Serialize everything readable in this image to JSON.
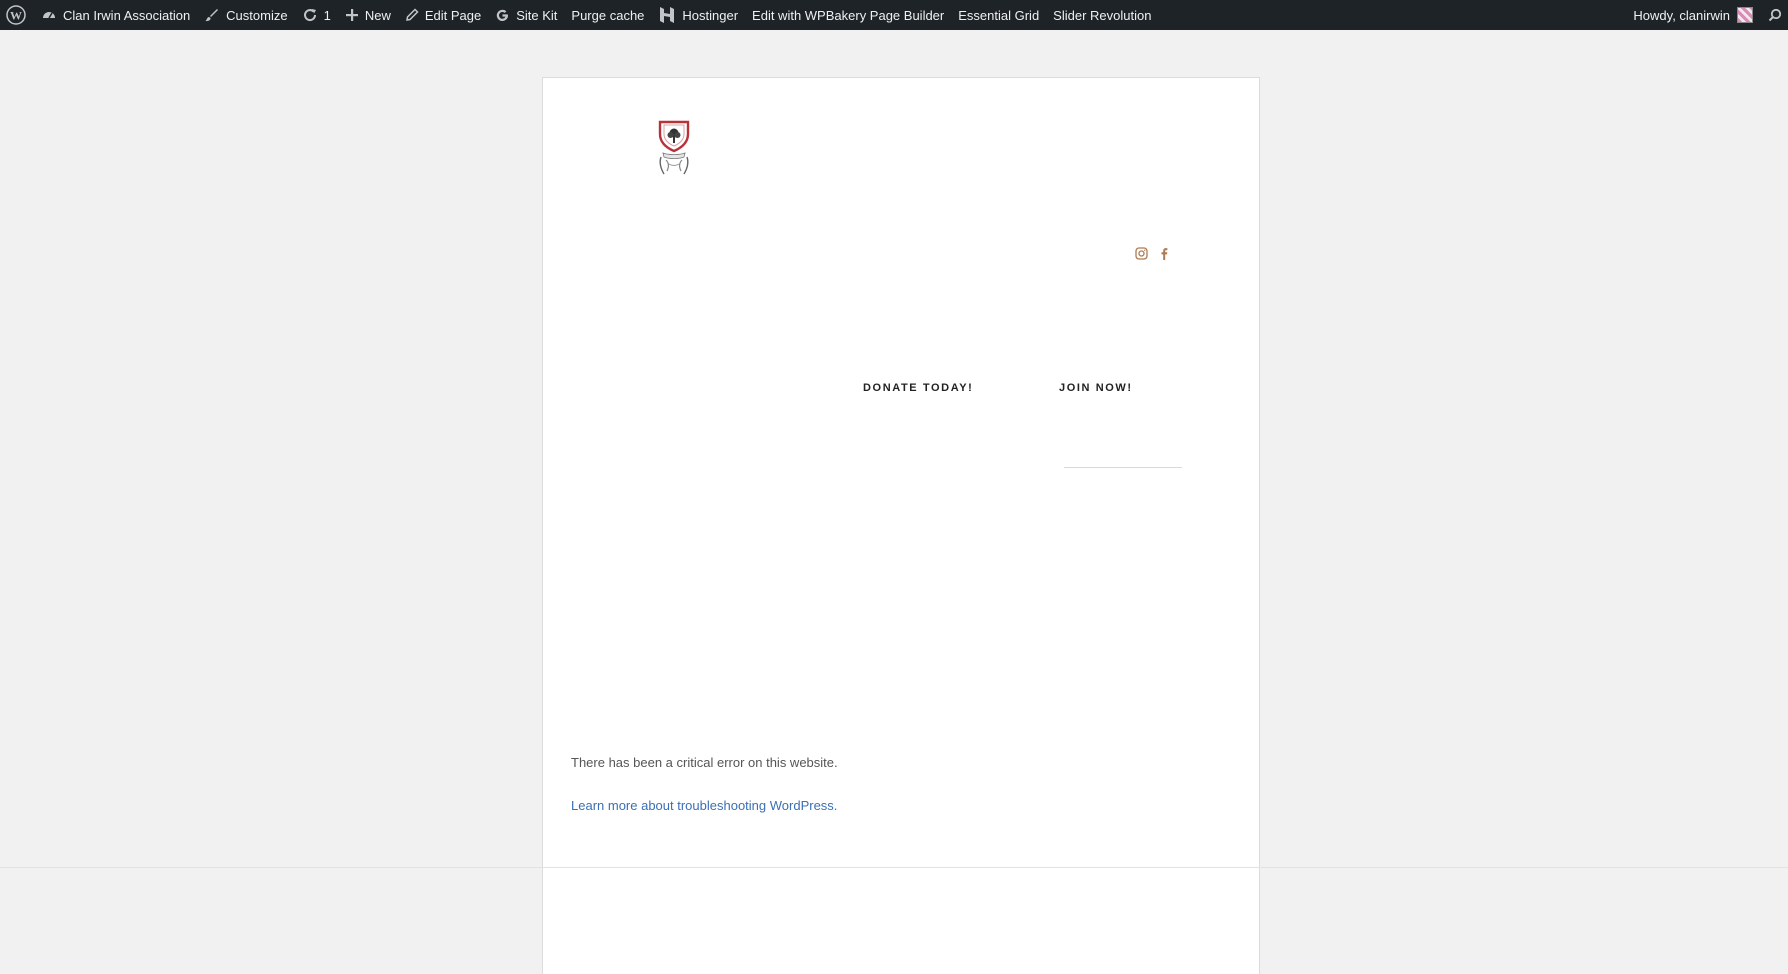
{
  "admin_bar": {
    "site_name": "Clan Irwin Association",
    "customize": "Customize",
    "updates_count": "1",
    "new": "New",
    "edit_page": "Edit Page",
    "site_kit": "Site Kit",
    "purge_cache": "Purge cache",
    "hostinger": "Hostinger",
    "wpbakery": "Edit with WPBakery Page Builder",
    "essential_grid": "Essential Grid",
    "slider_revolution": "Slider Revolution",
    "howdy": "Howdy, clanirwin"
  },
  "header": {
    "nav": {
      "donate": "DONATE TODAY!",
      "join": "JOIN NOW!"
    },
    "social": [
      "instagram-icon",
      "facebook-icon"
    ]
  },
  "content": {
    "error_message": "There has been a critical error on this website.",
    "error_link": "Learn more about troubleshooting WordPress."
  },
  "colors": {
    "admin_bar": "#1d2327",
    "accent_social": "#b07a50",
    "link": "#3b6fb6"
  }
}
